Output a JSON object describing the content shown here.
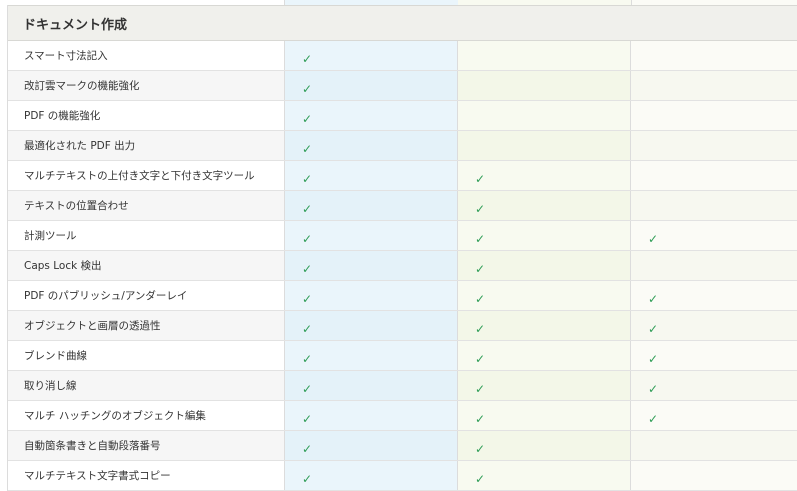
{
  "section": {
    "title": "ドキュメント作成"
  },
  "check_glyph": "✓",
  "colors": {
    "check": "#2f9d57",
    "edition1_bg": "#eaf5fb",
    "edition2_bg": "#f8faf0",
    "edition3_bg": "#fbfbf6",
    "header_bg": "#f0f0ec"
  },
  "rows": [
    {
      "label": "スマート寸法記入",
      "checks": [
        true,
        false,
        false
      ]
    },
    {
      "label": "改訂雲マークの機能強化",
      "checks": [
        true,
        false,
        false
      ]
    },
    {
      "label": "PDF の機能強化",
      "checks": [
        true,
        false,
        false
      ]
    },
    {
      "label": "最適化された PDF 出力",
      "checks": [
        true,
        false,
        false
      ]
    },
    {
      "label": "マルチテキストの上付き文字と下付き文字ツール",
      "checks": [
        true,
        true,
        false
      ]
    },
    {
      "label": "テキストの位置合わせ",
      "checks": [
        true,
        true,
        false
      ]
    },
    {
      "label": "計測ツール",
      "checks": [
        true,
        true,
        true
      ]
    },
    {
      "label": "Caps Lock 検出",
      "checks": [
        true,
        true,
        false
      ]
    },
    {
      "label": "PDF のパブリッシュ/アンダーレイ",
      "checks": [
        true,
        true,
        true
      ]
    },
    {
      "label": "オブジェクトと画層の透過性",
      "checks": [
        true,
        true,
        true
      ]
    },
    {
      "label": "ブレンド曲線",
      "checks": [
        true,
        true,
        true
      ]
    },
    {
      "label": "取り消し線",
      "checks": [
        true,
        true,
        true
      ]
    },
    {
      "label": "マルチ ハッチングのオブジェクト編集",
      "checks": [
        true,
        true,
        true
      ]
    },
    {
      "label": "自動箇条書きと自動段落番号",
      "checks": [
        true,
        true,
        false
      ]
    },
    {
      "label": "マルチテキスト文字書式コピー",
      "checks": [
        true,
        true,
        false
      ]
    }
  ]
}
